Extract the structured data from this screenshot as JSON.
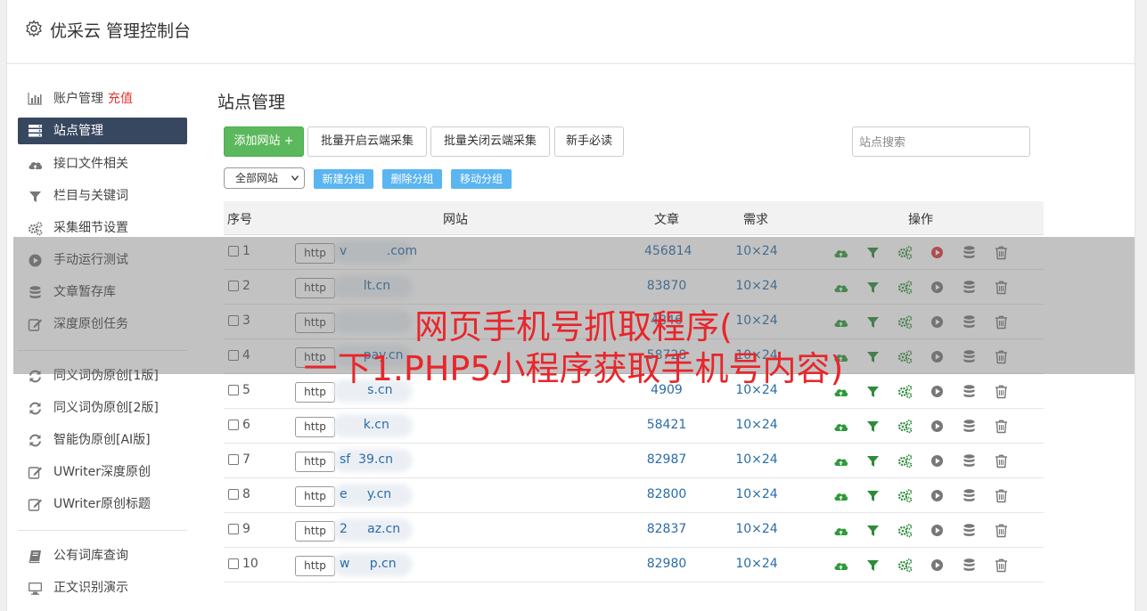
{
  "app": {
    "title": "优采云 管理控制台"
  },
  "sidebar": {
    "items": [
      {
        "label": "账户管理",
        "extra": "充值",
        "icon": "bar-chart-icon"
      },
      {
        "label": "站点管理",
        "icon": "server-icon",
        "active": true
      },
      {
        "label": "接口文件相关",
        "icon": "cloud-upload-icon"
      },
      {
        "label": "栏目与关键词",
        "icon": "filter-icon"
      },
      {
        "label": "采集细节设置",
        "icon": "gears-icon"
      },
      {
        "label": "手动运行测试",
        "icon": "play-circle-icon"
      },
      {
        "label": "文章暂存库",
        "icon": "database-icon"
      },
      {
        "label": "深度原创任务",
        "icon": "edit-icon"
      }
    ],
    "items2": [
      {
        "label": "同义词伪原创[1版]",
        "icon": "refresh-icon"
      },
      {
        "label": "同义词伪原创[2版]",
        "icon": "refresh-icon"
      },
      {
        "label": "智能伪原创[AI版]",
        "icon": "refresh-icon"
      },
      {
        "label": "UWriter深度原创",
        "icon": "edit-icon"
      },
      {
        "label": "UWriter原创标题",
        "icon": "edit-icon"
      }
    ],
    "items3": [
      {
        "label": "公有词库查询",
        "icon": "book-icon"
      },
      {
        "label": "正文识别演示",
        "icon": "monitor-icon"
      }
    ]
  },
  "main": {
    "title": "站点管理",
    "buttons": {
      "add_site": "添加网站 +",
      "batch_open": "批量开启云端采集",
      "batch_close": "批量关闭云端采集",
      "newbie": "新手必读"
    },
    "search_placeholder": "站点搜索",
    "group_select": "全部网站",
    "group_buttons": {
      "new_group": "新建分组",
      "delete_group": "删除分组",
      "move_group": "移动分组"
    },
    "table": {
      "headers": {
        "index": "序号",
        "site": "网站",
        "articles": "文章",
        "demand": "需求",
        "actions": "操作"
      },
      "rows": [
        {
          "index": "1",
          "protocol": "http",
          "site": "v          .com",
          "articles": "456814",
          "demand": "10×24",
          "running": true
        },
        {
          "index": "2",
          "protocol": "http",
          "site": "      lt.cn",
          "articles": "83870",
          "demand": "10×24",
          "running": false
        },
        {
          "index": "3",
          "protocol": "http",
          "site": "",
          "articles": "4846",
          "demand": "10×24",
          "running": false
        },
        {
          "index": "4",
          "protocol": "http",
          "site": "      pay.cn",
          "articles": "58728",
          "demand": "10×24",
          "running": false
        },
        {
          "index": "5",
          "protocol": "http",
          "site": "       s.cn",
          "articles": "4909",
          "demand": "10×24",
          "running": false
        },
        {
          "index": "6",
          "protocol": "http",
          "site": "      k.cn",
          "articles": "58421",
          "demand": "10×24",
          "running": false
        },
        {
          "index": "7",
          "protocol": "http",
          "site": "sf  39.cn",
          "articles": "82987",
          "demand": "10×24",
          "running": false
        },
        {
          "index": "8",
          "protocol": "http",
          "site": "e     y.cn",
          "articles": "82800",
          "demand": "10×24",
          "running": false
        },
        {
          "index": "9",
          "protocol": "http",
          "site": "2     az.cn",
          "articles": "82837",
          "demand": "10×24",
          "running": false
        },
        {
          "index": "10",
          "protocol": "http",
          "site": "w     p.cn",
          "articles": "82980",
          "demand": "10×24",
          "running": false
        }
      ]
    }
  },
  "overlay": {
    "line1": "网页手机号抓取程序(",
    "line2": "一下1.PHP5小程序获取手机号内容)"
  },
  "colors": {
    "accent_green": "#5cb85c",
    "sidebar_active": "#37475f",
    "link_blue": "#2a6ca8",
    "group_button_blue": "#5bb5f0",
    "headline_red": "#e8262b",
    "recharge_red": "#e8332f"
  }
}
